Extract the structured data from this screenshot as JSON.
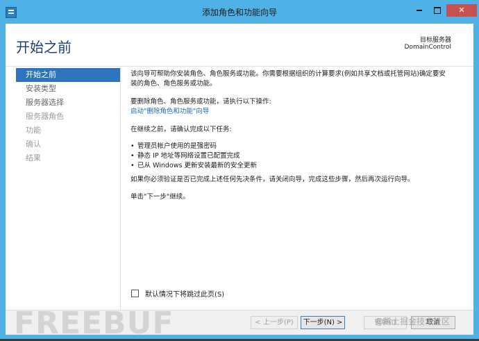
{
  "window": {
    "title": "添加角色和功能向导",
    "controls": {
      "minimize": "minimize",
      "maximize": "maximize",
      "close": "✕"
    }
  },
  "header": {
    "page_title": "开始之前",
    "target_label": "目标服务器",
    "target_value": "DomainControl"
  },
  "nav": {
    "items": [
      {
        "label": "开始之前",
        "state": "active"
      },
      {
        "label": "安装类型",
        "state": "enabled"
      },
      {
        "label": "服务器选择",
        "state": "enabled"
      },
      {
        "label": "服务器角色",
        "state": "disabled"
      },
      {
        "label": "功能",
        "state": "disabled"
      },
      {
        "label": "确认",
        "state": "disabled"
      },
      {
        "label": "结果",
        "state": "disabled"
      }
    ]
  },
  "content": {
    "intro": "该向导可帮助你安装角色、角色服务或功能。你需要根据组织的计算要求(例如共享文档或托管网站)确定要安装的角色、角色服务或功能。",
    "remove_text": "要删除角色、角色服务或功能，请执行以下操作:",
    "remove_link": "启动\"删除角色和功能\"向导",
    "before_text": "在继续之前，请确认完成以下任务:",
    "tasks": [
      "管理员帐户使用的是强密码",
      "静态 IP 地址等网络设置已配置完成",
      "已从 Windows 更新安装最新的安全更新"
    ],
    "verify_text": "如果你必须验证是否已完成上述任何先决条件，请关闭向导，完成这些步骤，然后再次运行向导。",
    "continue_text": "单击\"下一步\"继续。"
  },
  "skip_checkbox": {
    "label": "默认情况下将跳过此页(S)",
    "checked": false
  },
  "footer": {
    "prev": "< 上一步(P)",
    "next": "下一步(N) >",
    "install": "安装(I)",
    "cancel": "取消"
  },
  "watermark": {
    "logo_text": "FREEBUF",
    "overlay_text": "@稀土掘金技术社区"
  },
  "colors": {
    "frame": "#4fb1e6",
    "nav_active": "#2e74bc",
    "title": "#1e3f73",
    "link": "#1f65b0",
    "close": "#c75050"
  }
}
